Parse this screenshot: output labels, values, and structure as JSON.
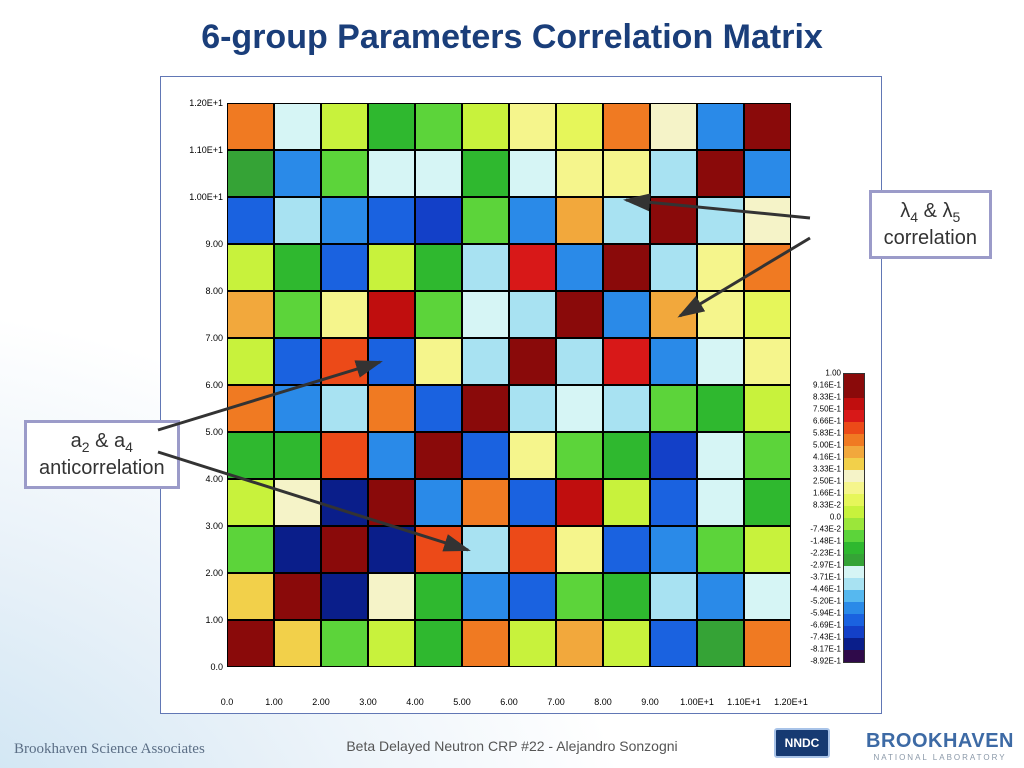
{
  "title": "6-group Parameters Correlation Matrix",
  "footer": "Beta Delayed Neutron CRP  #22  -  Alejandro Sonzogni",
  "logo_left": "Brookhaven Science Associates",
  "logo_nndc": "NNDC",
  "logo_bnl_main": "BROOKHAVEN",
  "logo_bnl_sub": "NATIONAL LABORATORY",
  "callout_right_line1_a": "λ",
  "callout_right_line1_b": "4",
  "callout_right_line1_c": " & λ",
  "callout_right_line1_d": "5",
  "callout_right_line2": "correlation",
  "callout_left_line1_a": "a",
  "callout_left_line1_b": "2",
  "callout_left_line1_c": " & a",
  "callout_left_line1_d": "4",
  "callout_left_line2": "anticorrelation",
  "chart_data": {
    "type": "heatmap",
    "title": "6-group Parameters Correlation Matrix",
    "xlabel": "",
    "ylabel": "",
    "x_ticks": [
      "0.0",
      "1.00",
      "2.00",
      "3.00",
      "4.00",
      "5.00",
      "6.00",
      "7.00",
      "8.00",
      "9.00",
      "1.00E+1",
      "1.10E+1",
      "1.20E+1"
    ],
    "y_ticks": [
      "0.0",
      "1.00",
      "2.00",
      "3.00",
      "4.00",
      "5.00",
      "6.00",
      "7.00",
      "8.00",
      "9.00",
      "1.00E+1",
      "1.10E+1",
      "1.20E+1"
    ],
    "n": 12,
    "matrix_index": [
      [
        22,
        16,
        10,
        12,
        9,
        18,
        12,
        17,
        12,
        3,
        8,
        18
      ],
      [
        16,
        22,
        1,
        15,
        9,
        4,
        3,
        10,
        9,
        6,
        4,
        7
      ],
      [
        10,
        1,
        22,
        1,
        19,
        6,
        19,
        14,
        3,
        4,
        10,
        12
      ],
      [
        12,
        15,
        1,
        22,
        4,
        18,
        3,
        21,
        12,
        3,
        7,
        9
      ],
      [
        9,
        9,
        19,
        4,
        22,
        3,
        14,
        10,
        9,
        2,
        7,
        10
      ],
      [
        18,
        4,
        6,
        18,
        3,
        22,
        6,
        7,
        6,
        10,
        9,
        12
      ],
      [
        12,
        3,
        19,
        3,
        14,
        6,
        22,
        6,
        20,
        4,
        7,
        14
      ],
      [
        17,
        10,
        14,
        21,
        10,
        7,
        6,
        22,
        4,
        17,
        14,
        13
      ],
      [
        12,
        9,
        3,
        12,
        9,
        6,
        20,
        4,
        22,
        6,
        14,
        18
      ],
      [
        3,
        6,
        4,
        3,
        2,
        10,
        4,
        17,
        6,
        22,
        6,
        15
      ],
      [
        8,
        4,
        10,
        7,
        7,
        9,
        7,
        14,
        14,
        6,
        22,
        4
      ],
      [
        18,
        7,
        12,
        9,
        10,
        12,
        14,
        13,
        18,
        15,
        4,
        22
      ]
    ],
    "palette": [
      "#2f0a4a",
      "#0a1e8a",
      "#1340c8",
      "#1a62e0",
      "#2a8ae8",
      "#56b8ef",
      "#a8e2f2",
      "#d6f5f5",
      "#35a336",
      "#2fb82f",
      "#5cd43a",
      "#9be63a",
      "#c8f23c",
      "#e6f65a",
      "#f5f58c",
      "#f5f3c8",
      "#f2d04a",
      "#f2a83c",
      "#f07a22",
      "#ec4a18",
      "#d81818",
      "#c00e0e",
      "#8a0a0a"
    ],
    "colorbar_labels": [
      "1.00",
      "9.16E-1",
      "8.33E-1",
      "7.50E-1",
      "6.66E-1",
      "5.83E-1",
      "5.00E-1",
      "4.16E-1",
      "3.33E-1",
      "2.50E-1",
      "1.66E-1",
      "8.33E-2",
      "0.0",
      "-7.43E-2",
      "-1.48E-1",
      "-2.23E-1",
      "-2.97E-1",
      "-3.71E-1",
      "-4.46E-1",
      "-5.20E-1",
      "-5.94E-1",
      "-6.69E-1",
      "-7.43E-1",
      "-8.17E-1",
      "-8.92E-1"
    ],
    "annotations": [
      {
        "text": "λ4 & λ5 correlation",
        "targets": [
          [
            8,
            7
          ],
          [
            9,
            10
          ]
        ]
      },
      {
        "text": "a2 & a4 anticorrelation",
        "targets": [
          [
            6,
            3
          ],
          [
            2,
            7
          ]
        ]
      }
    ]
  }
}
